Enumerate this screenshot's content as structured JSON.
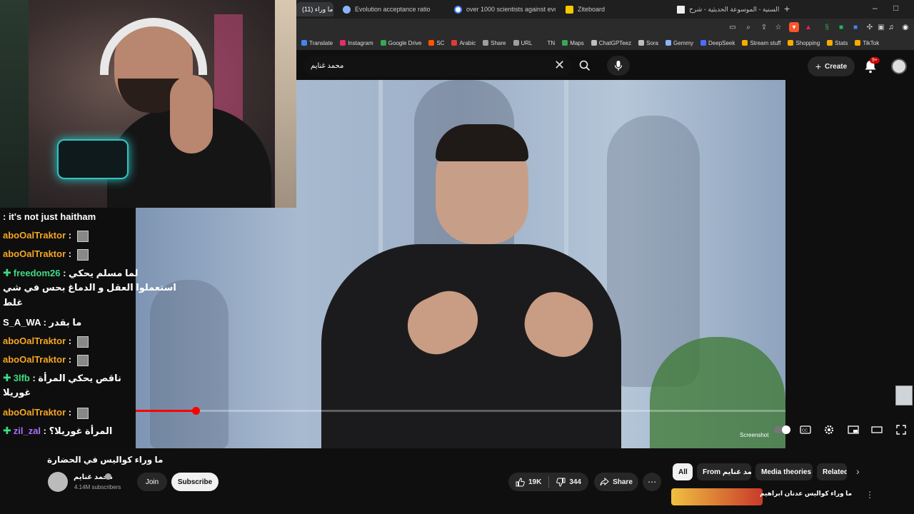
{
  "browser": {
    "tabs": [
      {
        "title": "(11) ما وراء",
        "active": true,
        "favicon": "youtube-icon",
        "color": "#ff0000"
      },
      {
        "title": "Evolution acceptance ratio",
        "active": false,
        "favicon": "page-icon",
        "color": "#8ab4f8"
      },
      {
        "title": "over 1000 scientists against evolution",
        "active": false,
        "favicon": "google-icon",
        "color": "#4285f4"
      },
      {
        "title": "Ziteboard",
        "active": false,
        "favicon": "ziteboard-icon",
        "color": "#f7c800"
      },
      {
        "title": "الدرر السنية - الموسوعة الحديثية - شرح",
        "active": false,
        "favicon": "page-icon",
        "color": "#eeeeee"
      }
    ],
    "new_tab": "+",
    "window_controls": [
      "–",
      "□"
    ],
    "bookmarks": [
      {
        "label": "Translate",
        "color": "#4285f4"
      },
      {
        "label": "Instagram",
        "color": "#e1306c"
      },
      {
        "label": "Google Drive",
        "color": "#34a853"
      },
      {
        "label": "SC",
        "color": "#ff5500"
      },
      {
        "label": "Arabic",
        "color": "#e53935"
      },
      {
        "label": "Share",
        "color": "#9e9e9e"
      },
      {
        "label": "URL",
        "color": "#9e9e9e"
      },
      {
        "label": "TN",
        "color": "#2b2b2b"
      },
      {
        "label": "Maps",
        "color": "#34a853"
      },
      {
        "label": "ChatGPTeez",
        "color": "#bdbdbd"
      },
      {
        "label": "Sora",
        "color": "#bdbdbd"
      },
      {
        "label": "Gemmy",
        "color": "#8ab4f8"
      },
      {
        "label": "DeepSeek",
        "color": "#4d6bfe"
      },
      {
        "label": "Stream stuff",
        "color": "#f9ab00"
      },
      {
        "label": "Shopping",
        "color": "#f9ab00"
      },
      {
        "label": "Stats",
        "color": "#f9ab00"
      },
      {
        "label": "TikTok",
        "color": "#f9ab00"
      }
    ]
  },
  "youtube": {
    "search_value": "محمد غنايم",
    "create_label": "Create",
    "notifications": "9+",
    "video": {
      "title": "ما وراء كواليس في الحضارة",
      "progress": 0.157,
      "screenshot_label": "Screenshot"
    },
    "channel": {
      "name": "محمد غنايم",
      "subscribers": "4.14M subscribers",
      "join_label": "Join",
      "subscribe_label": "Subscribe"
    },
    "actions": {
      "likes": "19K",
      "dislikes": "344",
      "share_label": "Share"
    },
    "chips": [
      "All",
      "From محمد غنايم",
      "Media theories",
      "Related"
    ],
    "recommended": {
      "title": "ما وراء كواليس عدنان ابراهيم"
    }
  },
  "chat": {
    "messages": [
      {
        "user": "",
        "text": ": it's not just haitham",
        "color": "#ffffff",
        "badge": false,
        "avatar": false
      },
      {
        "user": "aboOalTraktor",
        "text": " : ",
        "color": "#f5a623",
        "badge": false,
        "avatar": true
      },
      {
        "user": "aboOalTraktor",
        "text": " : ",
        "color": "#f5a623",
        "badge": false,
        "avatar": true
      },
      {
        "user": "freedom26",
        "text": " : لما مسلم يحكي",
        "color": "#3ddc84",
        "badge": true,
        "avatar": false
      },
      {
        "user": "",
        "text": "استعملوا العقل و الدماغ بحس في شي",
        "color": "#ffffff",
        "badge": false,
        "avatar": false
      },
      {
        "user": "",
        "text": "غلط",
        "color": "#ffffff",
        "badge": false,
        "avatar": false
      },
      {
        "user": "S_A_WA",
        "text": " : ما بقدر",
        "color": "#ffffff",
        "badge": false,
        "avatar": false
      },
      {
        "user": "aboOalTraktor",
        "text": " : ",
        "color": "#f5a623",
        "badge": false,
        "avatar": true
      },
      {
        "user": "aboOalTraktor",
        "text": " : ",
        "color": "#f5a623",
        "badge": false,
        "avatar": true
      },
      {
        "user": "3lfb",
        "text": " : ناقص يحكي المرأة",
        "color": "#3ddc84",
        "badge": true,
        "avatar": false
      },
      {
        "user": "",
        "text": "غوريلا",
        "color": "#ffffff",
        "badge": false,
        "avatar": false
      },
      {
        "user": "aboOalTraktor",
        "text": " : ",
        "color": "#f5a623",
        "badge": false,
        "avatar": true
      },
      {
        "user": "zil_zal",
        "text": " : المرأة غوريلا؟",
        "color": "#a970ff",
        "badge": true,
        "avatar": false
      }
    ]
  }
}
